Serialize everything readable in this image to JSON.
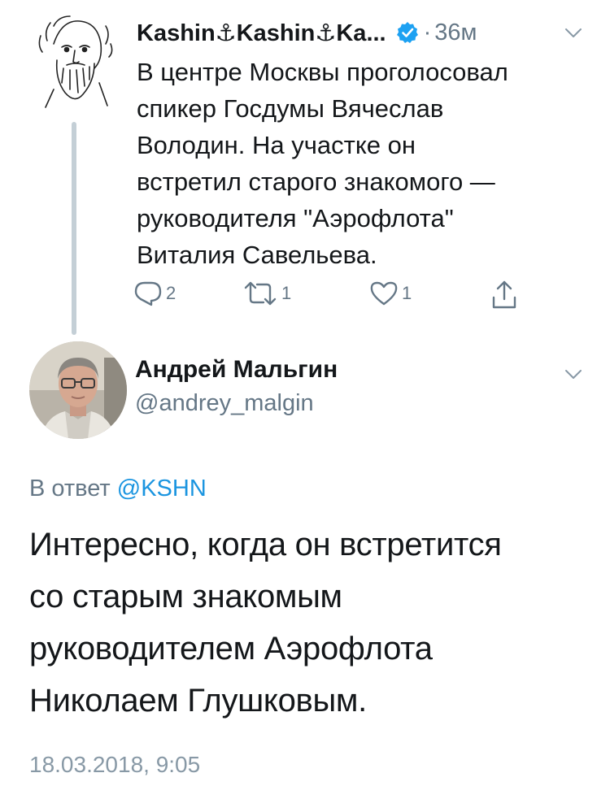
{
  "parent_tweet": {
    "display_name": "Kashin⚓Kashin⚓Ka...",
    "time": "36м",
    "dot": "·",
    "text": "В центре Москвы проголосовал\nспикер Госдумы Вячеслав\nВолодин. На участке он\nвстретил старого знакомого —\nруководителя \"Аэрофлота\"\nВиталия Савельева.",
    "reply_count": "2",
    "retweet_count": "1",
    "like_count": "1",
    "verified": true
  },
  "main_tweet": {
    "display_name": "Андрей Мальгин",
    "handle": "@andrey_malgin",
    "reply_prefix": "В ответ",
    "reply_mention": "@KSHN",
    "text": "Интересно, когда он встретится\nсо старым знакомым\nруководителем Аэрофлота\nНиколаем Глушковым.",
    "date": "18.03.2018, 9:05"
  },
  "colors": {
    "text": "#14171a",
    "secondary": "#657786",
    "link": "#1b95e0",
    "verified": "#1da1f2",
    "thread_line": "#c4cfd6"
  },
  "icons": [
    "verified-badge-icon",
    "chevron-down-icon",
    "reply-icon",
    "retweet-icon",
    "like-icon",
    "share-icon"
  ]
}
